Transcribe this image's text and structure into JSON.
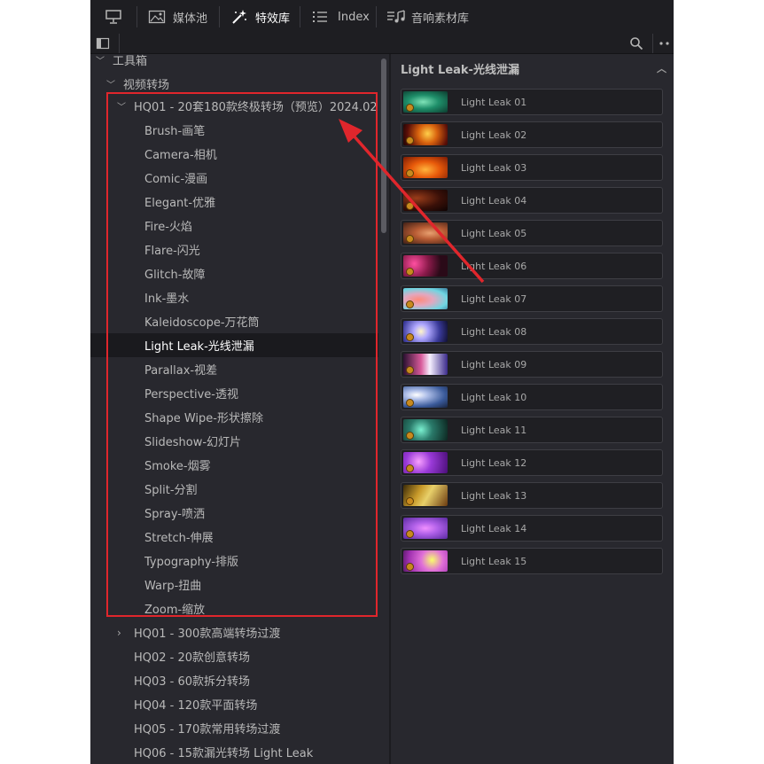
{
  "toolbar": {
    "media_pool": "媒体池",
    "effects": "特效库",
    "index": "Index",
    "sound_library": "音响素材库"
  },
  "tree": {
    "toolbox": "工具箱",
    "video_transitions": "视频转场",
    "group_expanded": "HQ01 - 20套180款终极转场（预览）2024.02",
    "items": [
      "Brush-画笔",
      "Camera-相机",
      "Comic-漫画",
      "Elegant-优雅",
      "Fire-火焰",
      "Flare-闪光",
      "Glitch-故障",
      "Ink-墨水",
      "Kaleidoscope-万花筒",
      "Light Leak-光线泄漏",
      "Parallax-视差",
      "Perspective-透视",
      "Shape Wipe-形状擦除",
      "Slideshow-幻灯片",
      "Smoke-烟雾",
      "Split-分割",
      "Spray-喷洒",
      "Stretch-伸展",
      "Typography-排版",
      "Warp-扭曲",
      "Zoom-缩放"
    ],
    "selected_item": "Light Leak-光线泄漏",
    "collapsed_groups": [
      "HQ01 - 300款高端转场过渡",
      "HQ02 - 20款创意转场",
      "HQ03 - 60款拆分转场",
      "HQ04 - 120款平面转场",
      "HQ05 - 170款常用转场过渡",
      "HQ06 - 15款漏光转场 Light Leak"
    ]
  },
  "panel": {
    "title": "Light Leak-光线泄漏",
    "effects": [
      "Light Leak 01",
      "Light Leak 02",
      "Light Leak 03",
      "Light Leak 04",
      "Light Leak 05",
      "Light Leak 06",
      "Light Leak 07",
      "Light Leak 08",
      "Light Leak 09",
      "Light Leak 10",
      "Light Leak 11",
      "Light Leak 12",
      "Light Leak 13",
      "Light Leak 14",
      "Light Leak 15"
    ]
  },
  "colors": {
    "annotation": "#e0262c",
    "panel_bg": "#28282e",
    "toolbar_bg": "#1e1e22"
  }
}
